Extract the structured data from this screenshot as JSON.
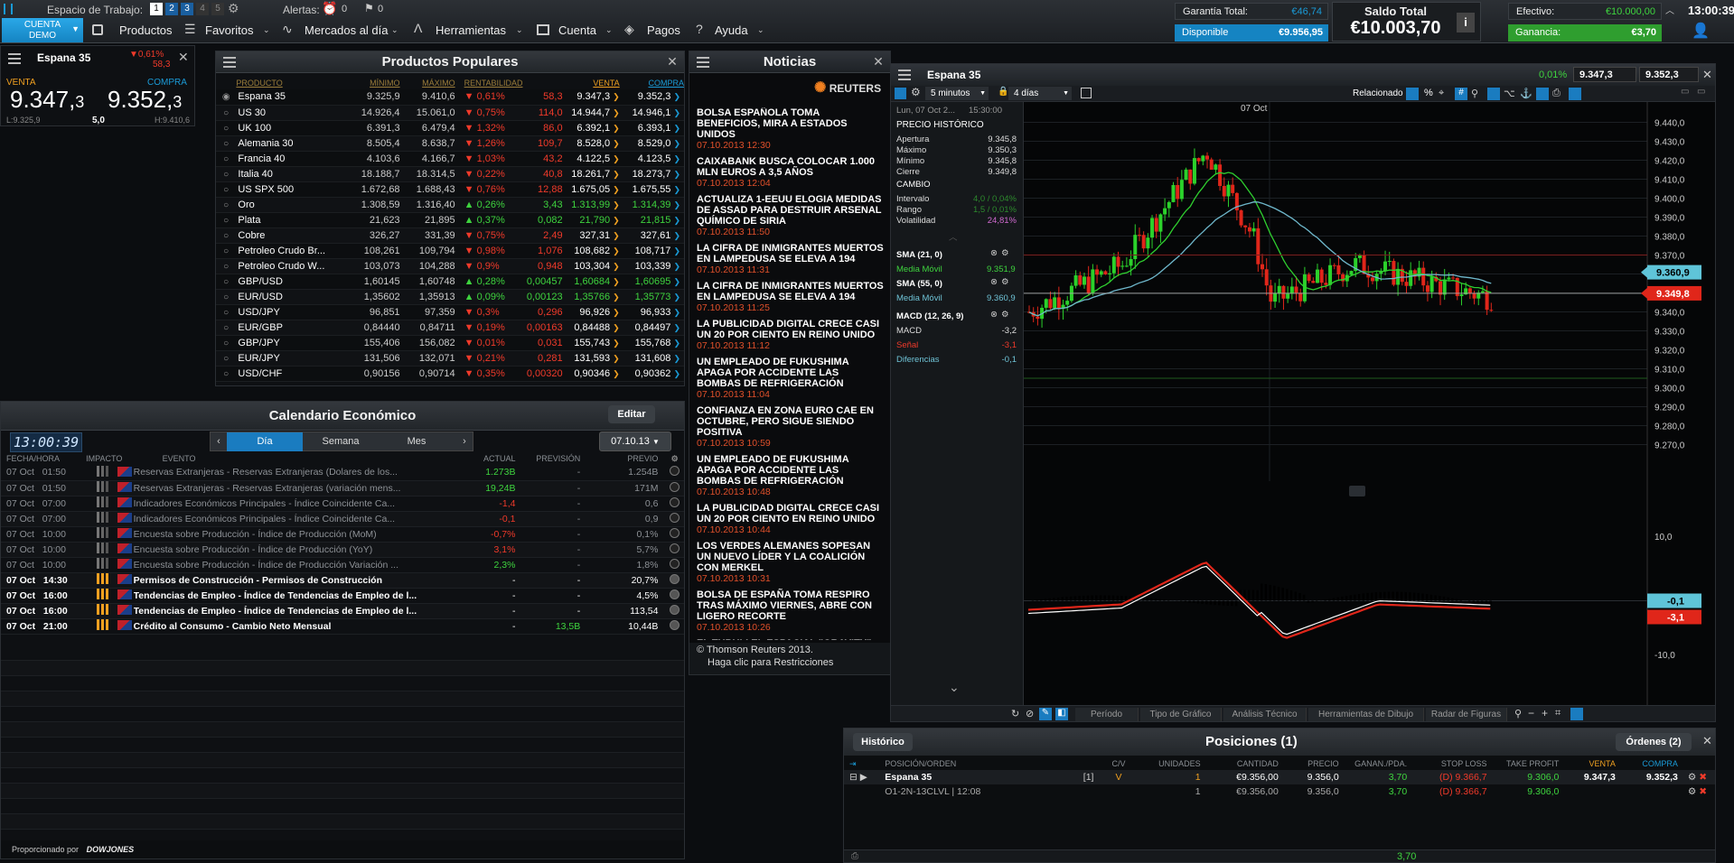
{
  "topbar": {
    "workspace_label": "Espacio de Trabajo:",
    "workspaces": [
      "1",
      "2",
      "3",
      "4",
      "5"
    ],
    "alerts_label": "Alertas:",
    "alerts_count1": "0",
    "alerts_count2": "0",
    "account_btn_line1": "CUENTA",
    "account_btn_line2": "DEMO",
    "menu": [
      "Productos",
      "Favoritos",
      "Mercados al día",
      "Herramientas",
      "Cuenta",
      "Pagos",
      "Ayuda"
    ],
    "garantia_label": "Garantía Total:",
    "garantia_value": "€46,74",
    "disponible_label": "Disponible",
    "disponible_value": "€9.956,95",
    "saldo_label": "Saldo Total",
    "saldo_value": "€10.003,70",
    "efectivo_label": "Efectivo:",
    "efectivo_value": "€10.000,00",
    "ganancia_label": "Ganancia:",
    "ganancia_value": "€3,70",
    "clock": "13:00:39"
  },
  "ticker": {
    "title": "Espana 35",
    "change_pct": "▼0,61%",
    "change_abs": "58,3",
    "venta_label": "VENTA",
    "compra_label": "COMPRA",
    "venta_main": "9.347,",
    "venta_small": "3",
    "compra_main": "9.352,",
    "compra_small": "3",
    "low": "L:9.325,9",
    "spread": "5,0",
    "high": "H:9.410,6"
  },
  "popular": {
    "title": "Productos Populares",
    "headers": [
      "PRODUCTO",
      "MÍNIMO",
      "MÁXIMO",
      "RENTABILIDAD",
      "",
      "VENTA",
      "COMPRA"
    ],
    "rows": [
      {
        "name": "Espana 35",
        "min": "9.325,9",
        "max": "9.410,6",
        "pct": "▼ 0,61%",
        "chg": "58,3",
        "dir": "down",
        "venta": "9.347,3",
        "compra": "9.352,3"
      },
      {
        "name": "US 30",
        "min": "14.926,4",
        "max": "15.061,0",
        "pct": "▼ 0,75%",
        "chg": "114,0",
        "dir": "down",
        "venta": "14.944,7",
        "compra": "14.946,1"
      },
      {
        "name": "UK 100",
        "min": "6.391,3",
        "max": "6.479,4",
        "pct": "▼ 1,32%",
        "chg": "86,0",
        "dir": "down",
        "venta": "6.392,1",
        "compra": "6.393,1"
      },
      {
        "name": "Alemania 30",
        "min": "8.505,4",
        "max": "8.638,7",
        "pct": "▼ 1,26%",
        "chg": "109,7",
        "dir": "down",
        "venta": "8.528,0",
        "compra": "8.529,0"
      },
      {
        "name": "Francia 40",
        "min": "4.103,6",
        "max": "4.166,7",
        "pct": "▼ 1,03%",
        "chg": "43,2",
        "dir": "down",
        "venta": "4.122,5",
        "compra": "4.123,5"
      },
      {
        "name": "Italia 40",
        "min": "18.188,7",
        "max": "18.314,5",
        "pct": "▼ 0,22%",
        "chg": "40,8",
        "dir": "down",
        "venta": "18.261,7",
        "compra": "18.273,7"
      },
      {
        "name": "US SPX 500",
        "min": "1.672,68",
        "max": "1.688,43",
        "pct": "▼ 0,76%",
        "chg": "12,88",
        "dir": "down",
        "venta": "1.675,05",
        "compra": "1.675,55"
      },
      {
        "name": "Oro",
        "min": "1.308,59",
        "max": "1.316,40",
        "pct": "▲ 0,26%",
        "chg": "3,43",
        "dir": "up",
        "venta": "1.313,99",
        "compra": "1.314,39"
      },
      {
        "name": "Plata",
        "min": "21,623",
        "max": "21,895",
        "pct": "▲ 0,37%",
        "chg": "0,082",
        "dir": "up",
        "venta": "21,790",
        "compra": "21,815"
      },
      {
        "name": "Cobre",
        "min": "326,27",
        "max": "331,39",
        "pct": "▼ 0,75%",
        "chg": "2,49",
        "dir": "down",
        "venta": "327,31",
        "compra": "327,61"
      },
      {
        "name": "Petroleo Crudo Br...",
        "min": "108,261",
        "max": "109,794",
        "pct": "▼ 0,98%",
        "chg": "1,076",
        "dir": "down",
        "venta": "108,682",
        "compra": "108,717"
      },
      {
        "name": "Petroleo Crudo W...",
        "min": "103,073",
        "max": "104,288",
        "pct": "▼ 0,9%",
        "chg": "0,948",
        "dir": "down",
        "venta": "103,304",
        "compra": "103,339"
      },
      {
        "name": "GBP/USD",
        "min": "1,60145",
        "max": "1,60748",
        "pct": "▲ 0,28%",
        "chg": "0,00457",
        "dir": "up",
        "venta": "1,60684",
        "compra": "1,60695"
      },
      {
        "name": "EUR/USD",
        "min": "1,35602",
        "max": "1,35913",
        "pct": "▲ 0,09%",
        "chg": "0,00123",
        "dir": "up",
        "venta": "1,35766",
        "compra": "1,35773"
      },
      {
        "name": "USD/JPY",
        "min": "96,851",
        "max": "97,359",
        "pct": "▼ 0,3%",
        "chg": "0,296",
        "dir": "down",
        "venta": "96,926",
        "compra": "96,933"
      },
      {
        "name": "EUR/GBP",
        "min": "0,84440",
        "max": "0,84711",
        "pct": "▼ 0,19%",
        "chg": "0,00163",
        "dir": "down",
        "venta": "0,84488",
        "compra": "0,84497"
      },
      {
        "name": "GBP/JPY",
        "min": "155,406",
        "max": "156,082",
        "pct": "▼ 0,01%",
        "chg": "0,031",
        "dir": "down",
        "venta": "155,743",
        "compra": "155,768"
      },
      {
        "name": "EUR/JPY",
        "min": "131,506",
        "max": "132,071",
        "pct": "▼ 0,21%",
        "chg": "0,281",
        "dir": "down",
        "venta": "131,593",
        "compra": "131,608"
      },
      {
        "name": "USD/CHF",
        "min": "0,90156",
        "max": "0,90714",
        "pct": "▼ 0,35%",
        "chg": "0,00320",
        "dir": "down",
        "venta": "0,90346",
        "compra": "0,90362"
      }
    ]
  },
  "calendar": {
    "title": "Calendario Económico",
    "edit_label": "Editar",
    "clock": "13:00:39",
    "tabs": [
      "Día",
      "Semana",
      "Mes"
    ],
    "date": "07.10.13",
    "headers": [
      "FECHA/HORA",
      "IMPACTO",
      "EVENTO",
      "ACTUAL",
      "PREVISIÓN",
      "PREVIO"
    ],
    "rows": [
      {
        "date": "07 Oct",
        "time": "01:50",
        "event": "Reservas Extranjeras - Reservas Extranjeras (Dolares de los...",
        "actual": "1.273B",
        "prev": "-",
        "previo": "1.254B",
        "hl": false,
        "ac": "green"
      },
      {
        "date": "07 Oct",
        "time": "01:50",
        "event": "Reservas Extranjeras - Reservas Extranjeras (variación mens...",
        "actual": "19,24B",
        "prev": "-",
        "previo": "171M",
        "hl": false,
        "ac": "green"
      },
      {
        "date": "07 Oct",
        "time": "07:00",
        "event": "Indicadores Económicos Principales - Índice Coincidente Ca...",
        "actual": "-1,4",
        "prev": "-",
        "previo": "0,6",
        "hl": false,
        "ac": "red"
      },
      {
        "date": "07 Oct",
        "time": "07:00",
        "event": "Indicadores Económicos Principales - Índice Coincidente Ca...",
        "actual": "-0,1",
        "prev": "-",
        "previo": "0,9",
        "hl": false,
        "ac": "red"
      },
      {
        "date": "07 Oct",
        "time": "10:00",
        "event": "Encuesta sobre Producción - Índice de Producción (MoM)",
        "actual": "-0,7%",
        "prev": "-",
        "previo": "0,1%",
        "hl": false,
        "ac": "red"
      },
      {
        "date": "07 Oct",
        "time": "10:00",
        "event": "Encuesta sobre Producción - Índice de Producción (YoY)",
        "actual": "3,1%",
        "prev": "-",
        "previo": "5,7%",
        "hl": false,
        "ac": "red"
      },
      {
        "date": "07 Oct",
        "time": "10:00",
        "event": "Encuesta sobre Producción - Índice de Producción Variación ...",
        "actual": "2,3%",
        "prev": "-",
        "previo": "1,8%",
        "hl": false,
        "ac": "green"
      },
      {
        "date": "07 Oct",
        "time": "14:30",
        "event": "Permisos de Construcción - Permisos de Construcción",
        "actual": "-",
        "prev": "-",
        "previo": "20,7%",
        "hl": true,
        "ac": ""
      },
      {
        "date": "07 Oct",
        "time": "16:00",
        "event": "Tendencias de Empleo - Índice de Tendencias de Empleo de l...",
        "actual": "-",
        "prev": "-",
        "previo": "4,5%",
        "hl": true,
        "ac": ""
      },
      {
        "date": "07 Oct",
        "time": "16:00",
        "event": "Tendencias de Empleo - Índice de Tendencias de Empleo de l...",
        "actual": "-",
        "prev": "-",
        "previo": "113,54",
        "hl": true,
        "ac": ""
      },
      {
        "date": "07 Oct",
        "time": "21:00",
        "event": "Crédito al Consumo - Cambio Neto Mensual",
        "actual": "-",
        "prev": "13,5B",
        "previo": "10,44B",
        "hl": true,
        "ac": ""
      }
    ],
    "footer": "Proporcionado por",
    "footer_brand": "DOWJONES"
  },
  "news": {
    "title": "Noticias",
    "source": "REUTERS",
    "items": [
      {
        "h": "BOLSA ESPAÑOLA TOMA BENEFICIOS, MIRA A ESTADOS UNIDOS",
        "t": "07.10.2013 12:30"
      },
      {
        "h": "CAIXABANK BUSCA COLOCAR 1.000 MLN EUROS A 3,5 AÑOS",
        "t": "07.10.2013 12:04"
      },
      {
        "h": "ACTUALIZA 1-EEUU ELOGIA MEDIDAS DE ASSAD PARA DESTRUIR ARSENAL QUÍMICO DE SIRIA",
        "t": "07.10.2013 11:50"
      },
      {
        "h": "LA CIFRA DE INMIGRANTES MUERTOS EN LAMPEDUSA SE ELEVA A 194",
        "t": "07.10.2013 11:31"
      },
      {
        "h": "LA CIFRA DE INMIGRANTES MUERTOS EN LAMPEDUSA SE ELEVA A 194",
        "t": "07.10.2013 11:25"
      },
      {
        "h": "LA PUBLICIDAD DIGITAL CRECE CASI UN 20 POR CIENTO EN REINO UNIDO",
        "t": "07.10.2013 11:12"
      },
      {
        "h": "UN EMPLEADO DE FUKUSHIMA APAGA POR ACCIDENTE LAS BOMBAS DE REFRIGERACIÓN",
        "t": "07.10.2013 11:04"
      },
      {
        "h": "CONFIANZA EN ZONA EURO CAE EN OCTUBRE, PERO SIGUE SIENDO POSITIVA",
        "t": "07.10.2013 10:59"
      },
      {
        "h": "UN EMPLEADO DE FUKUSHIMA APAGA POR ACCIDENTE LAS BOMBAS DE REFRIGERACIÓN",
        "t": "07.10.2013 10:48"
      },
      {
        "h": "LA PUBLICIDAD DIGITAL CRECE CASI UN 20 POR CIENTO EN REINO UNIDO",
        "t": "07.10.2013 10:44"
      },
      {
        "h": "LOS VERDES ALEMANES SOPESAN UN NUEVO LÍDER Y LA COALICIÓN CON MERKEL",
        "t": "07.10.2013 10:31"
      },
      {
        "h": "BOLSA DE ESPAÑA TOMA RESPIRO TRAS MÁXIMO VIERNES, ABRE CON LIGERO RECORTE",
        "t": "07.10.2013 10:26"
      },
      {
        "h": "EL TUBULI EL ESPACIAL \"GRAVITY\"",
        "t": ""
      }
    ],
    "copyright": "© Thomson Reuters 2013.",
    "restrictions": "Haga clic para Restricciones"
  },
  "chart": {
    "title": "Espana 35",
    "change": "0,01%",
    "venta": "9.347,3",
    "compra": "9.352,3",
    "interval": "5 minutos",
    "range": "4 días",
    "relacionado": "Relacionado",
    "date_label": "07 Oct",
    "info_date": "Lun, 07 Oct 2...",
    "info_time": "15:30:00",
    "precio_label": "PRECIO HISTÓRICO",
    "ohlc": [
      [
        "Apertura",
        "9.345,8"
      ],
      [
        "Máximo",
        "9.350,3"
      ],
      [
        "Mínimo",
        "9.345,8"
      ],
      [
        "Cierre",
        "9.349,8"
      ]
    ],
    "cambio_label": "CAMBIO",
    "stats": [
      [
        "Intervalo",
        "4,0 / 0,04%"
      ],
      [
        "Rango",
        "1,5 / 0,01%"
      ],
      [
        "Volatilidad",
        "24,81%"
      ]
    ],
    "sma1_label": "SMA (21, 0)",
    "sma1_name": "Media Móvil",
    "sma1_value": "9.351,9",
    "sma2_label": "SMA (55, 0)",
    "sma2_name": "Media Móvil",
    "sma2_value": "9.360,9",
    "macd_label": "MACD (12, 26, 9)",
    "macd_rows": [
      [
        "MACD",
        "-3,2"
      ],
      [
        "Señal",
        "-3,1"
      ],
      [
        "Diferencias",
        "-0,1"
      ]
    ],
    "yticks": [
      "9.440,0",
      "9.430,0",
      "9.420,0",
      "9.410,0",
      "9.400,0",
      "9.390,0",
      "9.380,0",
      "9.370,0",
      "9.360,0",
      "9.350,0",
      "9.340,0",
      "9.330,0",
      "9.320,0",
      "9.310,0",
      "9.300,0",
      "9.290,0",
      "9.280,0",
      "9.270,0"
    ],
    "price_tag1": "9.360,9",
    "price_tag2": "9.349,8",
    "macd_ticks": [
      "10,0",
      "-10,0"
    ],
    "macd_tag1": "-0,1",
    "macd_tag2": "-3,1",
    "bottom_tabs": [
      "Período",
      "Tipo de Gráfico",
      "Análisis Técnico",
      "Herramientas de Dibujo",
      "Radar de Figuras"
    ]
  },
  "chart_data": {
    "type": "line",
    "title": "Espana 35",
    "x": [
      "07 Oct"
    ],
    "series": [
      {
        "name": "Media Móvil",
        "values": [
          9351.9
        ]
      },
      {
        "name": "Media Móvil",
        "values": [
          9360.9
        ]
      }
    ],
    "last_close": 9349.8,
    "ylim": [
      9265,
      9445
    ]
  },
  "positions": {
    "title": "Posiciones (1)",
    "history_btn": "Histórico",
    "orders_btn": "Órdenes (2)",
    "headers": [
      "POSICIÓN/ORDEN",
      "C/V",
      "UNIDADES",
      "CANTIDAD",
      "PRECIO",
      "GANAN./PDA.",
      "STOP LOSS",
      "TAKE PROFIT",
      "VENTA",
      "COMPRA"
    ],
    "row1": {
      "name": "Espana 35",
      "count": "[1]",
      "cv": "V",
      "units": "1",
      "qty": "€9.356,00",
      "price": "9.356,0",
      "pl": "3,70",
      "sl": "(D) 9.366,7",
      "tp": "9.306,0",
      "venta": "9.347,3",
      "compra": "9.352,3"
    },
    "row2": {
      "name": "O1-2N-13CLVL | 12:08",
      "units": "1",
      "qty": "€9.356,00",
      "price": "9.356,0",
      "pl": "3,70",
      "sl": "(D) 9.366,7",
      "tp": "9.306,0"
    },
    "total": "3,70"
  },
  "colors": {
    "accent": "#1a9ad6",
    "up": "#3ed33e",
    "down": "#f03a2a",
    "orange": "#f0a020"
  }
}
